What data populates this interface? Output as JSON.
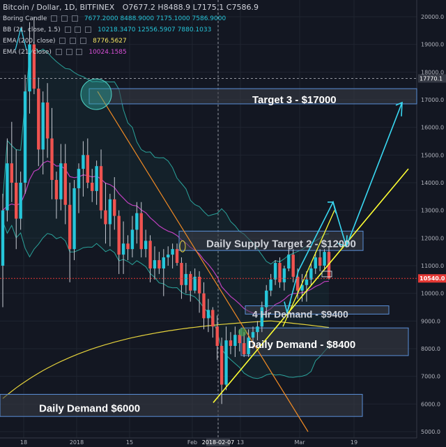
{
  "header": {
    "symbol": "Bitcoin / Dollar, 1D, BITFINEX",
    "ohlc_o": "O7677.2",
    "ohlc_h": "H8488.9",
    "ohlc_l": "L7175.1",
    "ohlc_c": "C7586.9",
    "indicators": [
      {
        "name": "Boring Candle",
        "values": "7677.2000  8488.9000  7175.1000  7586.9000",
        "color": "#26c6da"
      },
      {
        "name": "BB (21, close, 1.5)",
        "values": "10218.3470  12556.5907  7880.1033",
        "color": "#26c6da"
      },
      {
        "name": "EMA (200, close)",
        "values": "8776.5627",
        "color": "#f5e663"
      },
      {
        "name": "EMA (21, close)",
        "values": "10024.1585",
        "color": "#d84fd8"
      }
    ]
  },
  "colors": {
    "background": "#131722",
    "bull": "#26c6da",
    "bear": "#ef5350",
    "ema200": "#e6d33c",
    "ema21": "#c040c0",
    "bb": "#2aa39b",
    "trendline_yellow": "#ffff33",
    "trendline_orange": "#f08a24",
    "arrow": "#39d8f2",
    "zone_fill": "#3a3e47",
    "zone_border": "#5a8fd8",
    "price_label": "#e53935"
  },
  "chart_data": {
    "type": "candlestick",
    "ylim": [
      5000,
      20000
    ],
    "y_ticks": [
      "20000.0",
      "19000.0",
      "18000.0",
      "17000.0",
      "16000.0",
      "15000.0",
      "14000.0",
      "13000.0",
      "12000.0",
      "11000.0",
      "10000.0",
      "9000.0",
      "8000.0",
      "7000.0",
      "6000.0",
      "5000.0"
    ],
    "x_ticks": [
      "18",
      "2018",
      "15",
      "Feb",
      "2018-02-07",
      "13",
      "Mar",
      "19"
    ],
    "current_price": "10540.0",
    "marker_price": "17770.1",
    "annotations": {
      "target3": "Target 3 - $17000",
      "supply": "Daily Supply Target 2 - $12000",
      "demand4h": "4 Hr Demand - $9400",
      "demand8400": "Daily Demand - $8400",
      "demand6000": "Daily Demand $6000"
    },
    "candles": [
      [
        11000,
        13600,
        9500,
        13000
      ],
      [
        13000,
        15600,
        12600,
        14700
      ],
      [
        14700,
        16200,
        13300,
        14000
      ],
      [
        14000,
        15200,
        11600,
        12700
      ],
      [
        12700,
        14400,
        12300,
        14000
      ],
      [
        14000,
        17900,
        13600,
        17300
      ],
      [
        17300,
        19800,
        16500,
        19000
      ],
      [
        19000,
        20000,
        17200,
        17400
      ],
      [
        17400,
        17800,
        14600,
        15200
      ],
      [
        15200,
        17300,
        14300,
        16900
      ],
      [
        16900,
        17600,
        14900,
        15600
      ],
      [
        15600,
        16700,
        13400,
        14100
      ],
      [
        14100,
        14400,
        12700,
        13400
      ],
      [
        13400,
        15400,
        13000,
        14700
      ],
      [
        14700,
        15400,
        12500,
        13200
      ],
      [
        13200,
        14000,
        10400,
        11600
      ],
      [
        11600,
        14100,
        11200,
        13800
      ],
      [
        13800,
        14700,
        12900,
        14500
      ],
      [
        14500,
        15500,
        13500,
        15000
      ],
      [
        15000,
        15600,
        13800,
        14000
      ],
      [
        14000,
        14500,
        13300,
        13700
      ],
      [
        13700,
        14800,
        13200,
        14600
      ],
      [
        14600,
        15200,
        12700,
        13000
      ],
      [
        13000,
        14000,
        11800,
        12500
      ],
      [
        12500,
        13600,
        11700,
        13400
      ],
      [
        13400,
        14200,
        12300,
        12800
      ],
      [
        12800,
        13000,
        10700,
        11400
      ],
      [
        11400,
        12600,
        10700,
        11800
      ],
      [
        11800,
        12100,
        11200,
        11600
      ],
      [
        11600,
        12800,
        11300,
        12300
      ],
      [
        12300,
        13300,
        11800,
        12900
      ],
      [
        12900,
        13300,
        11300,
        11600
      ],
      [
        11600,
        12300,
        11300,
        11900
      ],
      [
        11900,
        12100,
        10400,
        10900
      ],
      [
        10900,
        11700,
        10500,
        11200
      ],
      [
        11200,
        11500,
        10700,
        10900
      ],
      [
        10900,
        11600,
        9900,
        11300
      ],
      [
        11300,
        11700,
        11000,
        11400
      ],
      [
        11400,
        11800,
        10900,
        11600
      ],
      [
        11600,
        11800,
        11000,
        11100
      ],
      [
        11100,
        11300,
        9800,
        10300
      ],
      [
        10300,
        11100,
        10000,
        10700
      ],
      [
        10700,
        10800,
        9700,
        10100
      ],
      [
        10100,
        10900,
        10000,
        10600
      ],
      [
        10600,
        10800,
        9300,
        10000
      ],
      [
        10000,
        10400,
        8700,
        9100
      ],
      [
        9100,
        9800,
        8600,
        9400
      ],
      [
        9400,
        9500,
        8400,
        8800
      ],
      [
        8800,
        9200,
        7600,
        8100
      ],
      [
        8100,
        8400,
        6000,
        6700
      ],
      [
        6700,
        8800,
        6500,
        8300
      ],
      [
        8300,
        8600,
        7800,
        8100
      ],
      [
        8100,
        8800,
        7700,
        8500
      ],
      [
        8500,
        8700,
        7900,
        8200
      ],
      [
        8200,
        8600,
        7700,
        7800
      ],
      [
        7800,
        8700,
        7700,
        8400
      ],
      [
        8400,
        8800,
        8000,
        8600
      ],
      [
        8600,
        9000,
        8300,
        8800
      ],
      [
        8800,
        9700,
        8600,
        9500
      ],
      [
        9500,
        10300,
        9300,
        10100
      ],
      [
        10100,
        10700,
        9900,
        10500
      ],
      [
        10500,
        11200,
        10300,
        11100
      ],
      [
        11100,
        11300,
        10200,
        10400
      ],
      [
        10400,
        11000,
        10100,
        10900
      ],
      [
        10900,
        11700,
        10800,
        11400
      ],
      [
        11400,
        11600,
        10400,
        10600
      ],
      [
        10600,
        10900,
        9800,
        10100
      ],
      [
        10100,
        10700,
        9700,
        10300
      ],
      [
        10300,
        10800,
        9700,
        10500
      ],
      [
        10500,
        11100,
        10300,
        10900
      ],
      [
        10900,
        11500,
        10700,
        11300
      ],
      [
        11300,
        11600,
        10800,
        11000
      ],
      [
        11000,
        11600,
        10900,
        11500
      ],
      [
        11500,
        11700,
        10500,
        10540
      ]
    ]
  }
}
